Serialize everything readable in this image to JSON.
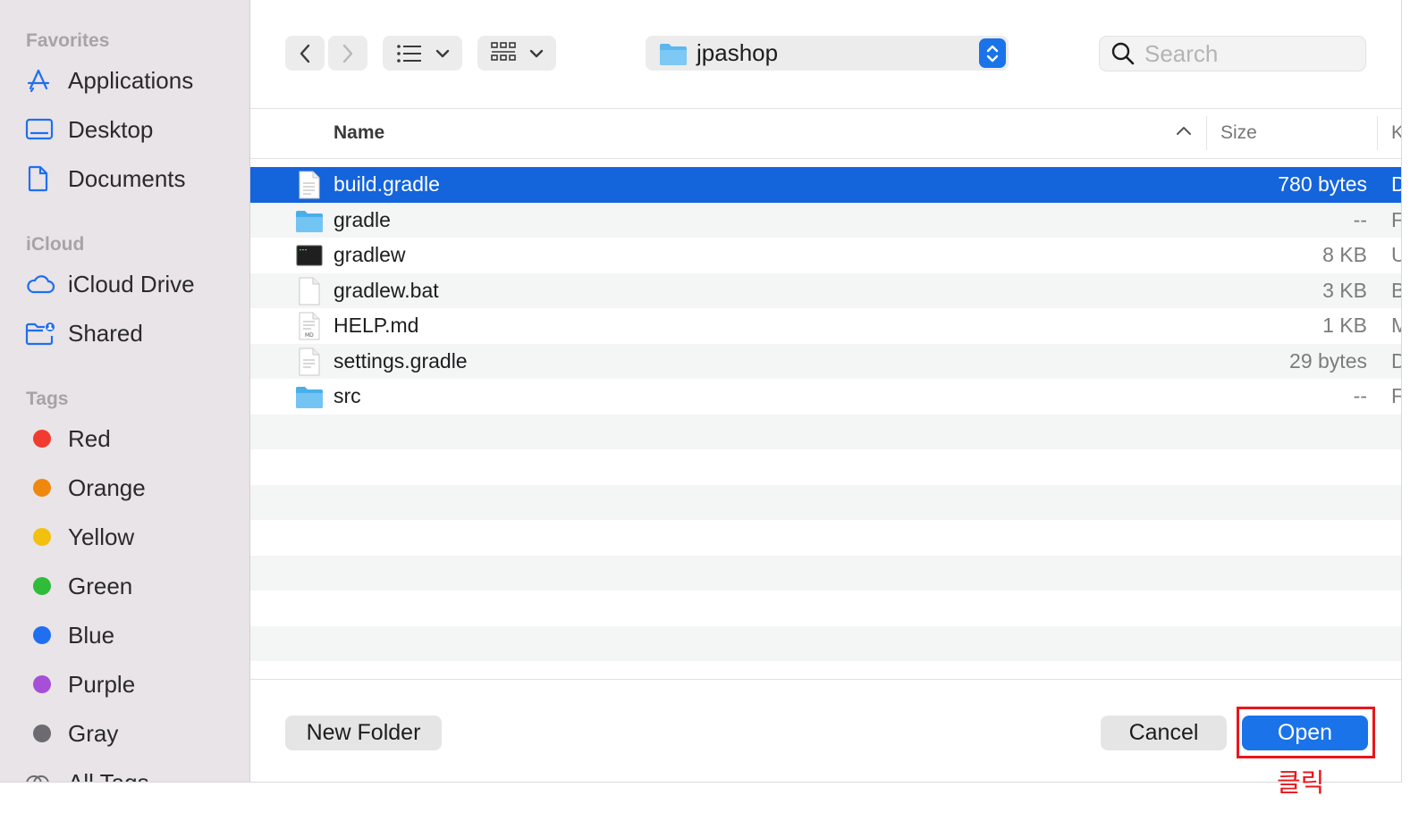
{
  "sidebar": {
    "sections": [
      {
        "title": "Favorites",
        "items": [
          {
            "label": "Applications",
            "icon": "applications-icon"
          },
          {
            "label": "Desktop",
            "icon": "desktop-icon"
          },
          {
            "label": "Documents",
            "icon": "documents-icon"
          }
        ]
      },
      {
        "title": "iCloud",
        "items": [
          {
            "label": "iCloud Drive",
            "icon": "icloud-icon"
          },
          {
            "label": "Shared",
            "icon": "shared-folder-icon"
          }
        ]
      },
      {
        "title": "Tags",
        "items": [
          {
            "label": "Red",
            "color": "#f23b30"
          },
          {
            "label": "Orange",
            "color": "#f0880f"
          },
          {
            "label": "Yellow",
            "color": "#f2c110"
          },
          {
            "label": "Green",
            "color": "#2ebc3a"
          },
          {
            "label": "Blue",
            "color": "#1f6ff0"
          },
          {
            "label": "Purple",
            "color": "#a64fd8"
          },
          {
            "label": "Gray",
            "color": "#6c6b6f"
          },
          {
            "label": "All Tags…",
            "color": ""
          }
        ]
      }
    ]
  },
  "toolbar": {
    "back_icon": "chevron-left-icon",
    "forward_icon": "chevron-right-icon",
    "list_view_icon": "list-view-icon",
    "group_icon": "grid-group-icon",
    "path": {
      "name": "jpashop",
      "icon": "folder-icon"
    },
    "search": {
      "placeholder": "Search",
      "value": ""
    }
  },
  "columns": {
    "name": "Name",
    "size": "Size",
    "kind": "Kind"
  },
  "files": [
    {
      "name": "build.gradle",
      "size": "780 bytes",
      "kind": "Document",
      "icon": "text-file-icon",
      "selected": true
    },
    {
      "name": "gradle",
      "size": "--",
      "kind": "Folder",
      "icon": "folder-icon",
      "selected": false
    },
    {
      "name": "gradlew",
      "size": "8 KB",
      "kind": "Unix executable",
      "icon": "terminal-icon",
      "selected": false
    },
    {
      "name": "gradlew.bat",
      "size": "3 KB",
      "kind": "Batch file",
      "icon": "blank-file-icon",
      "selected": false
    },
    {
      "name": "HELP.md",
      "size": "1 KB",
      "kind": "Markdown",
      "icon": "markdown-file-icon",
      "selected": false
    },
    {
      "name": "settings.gradle",
      "size": "29 bytes",
      "kind": "Document",
      "icon": "text-file-icon",
      "selected": false
    },
    {
      "name": "src",
      "size": "--",
      "kind": "Folder",
      "icon": "folder-icon",
      "selected": false
    }
  ],
  "footer": {
    "new_folder": "New Folder",
    "cancel": "Cancel",
    "open": "Open"
  },
  "annotation": {
    "label": "클릭",
    "color": "#e8161b"
  },
  "colors": {
    "accent": "#1a73e8",
    "selection": "#1464dc",
    "sidebar": "#e9e4e7"
  }
}
